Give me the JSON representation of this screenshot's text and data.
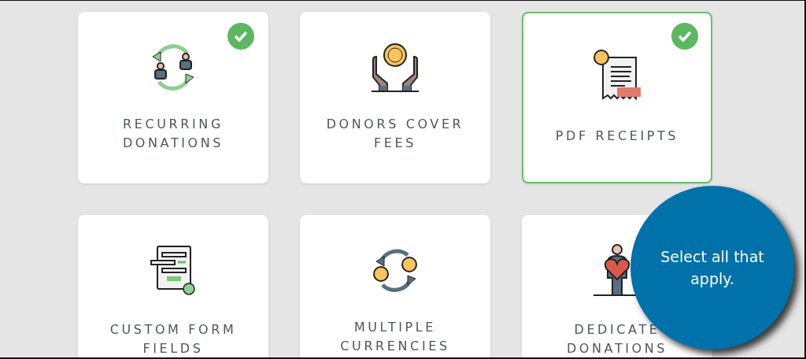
{
  "options": [
    {
      "lines": [
        "RECURRING",
        "DONATIONS"
      ],
      "selected": true,
      "focused": false
    },
    {
      "lines": [
        "DONORS COVER",
        "FEES"
      ],
      "selected": false,
      "focused": false
    },
    {
      "lines": [
        "PDF RECEIPTS"
      ],
      "selected": true,
      "focused": true
    },
    {
      "lines": [
        "CUSTOM FORM",
        "FIELDS"
      ],
      "selected": false,
      "focused": false
    },
    {
      "lines": [
        "MULTIPLE",
        "CURRENCIES"
      ],
      "selected": false,
      "focused": false
    },
    {
      "lines": [
        "DEDICATE",
        "DONATIONS"
      ],
      "selected": false,
      "focused": false
    }
  ],
  "callout": {
    "text": "Select all that apply."
  }
}
